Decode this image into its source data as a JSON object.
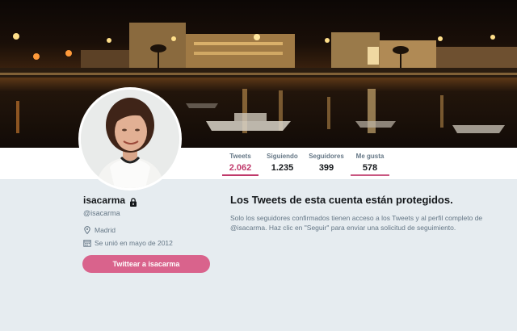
{
  "profile": {
    "name": "isacarma",
    "handle": "@isacarma",
    "location": "Madrid",
    "joined": "Se unió en mayo de 2012",
    "tweet_to_label": "Twittear a isacarma"
  },
  "nav": [
    {
      "label": "Tweets",
      "value": "2.062",
      "active": true
    },
    {
      "label": "Siguiendo",
      "value": "1.235",
      "active": false
    },
    {
      "label": "Seguidores",
      "value": "399",
      "active": false
    },
    {
      "label": "Me gusta",
      "value": "578",
      "active": false
    }
  ],
  "protected": {
    "title": "Los Tweets de esta cuenta están protegidos.",
    "body": "Solo los seguidores confirmados tienen acceso a los Tweets y al perfil completo de @isacarma. Haz clic en \"Seguir\" para enviar una solicitud de seguimiento."
  },
  "icons": {
    "lock": "lock-icon",
    "location": "location-pin-icon",
    "calendar": "calendar-icon"
  },
  "colors": {
    "accent": "#c0396b",
    "button": "#d9638c",
    "background": "#e6ecf0"
  }
}
